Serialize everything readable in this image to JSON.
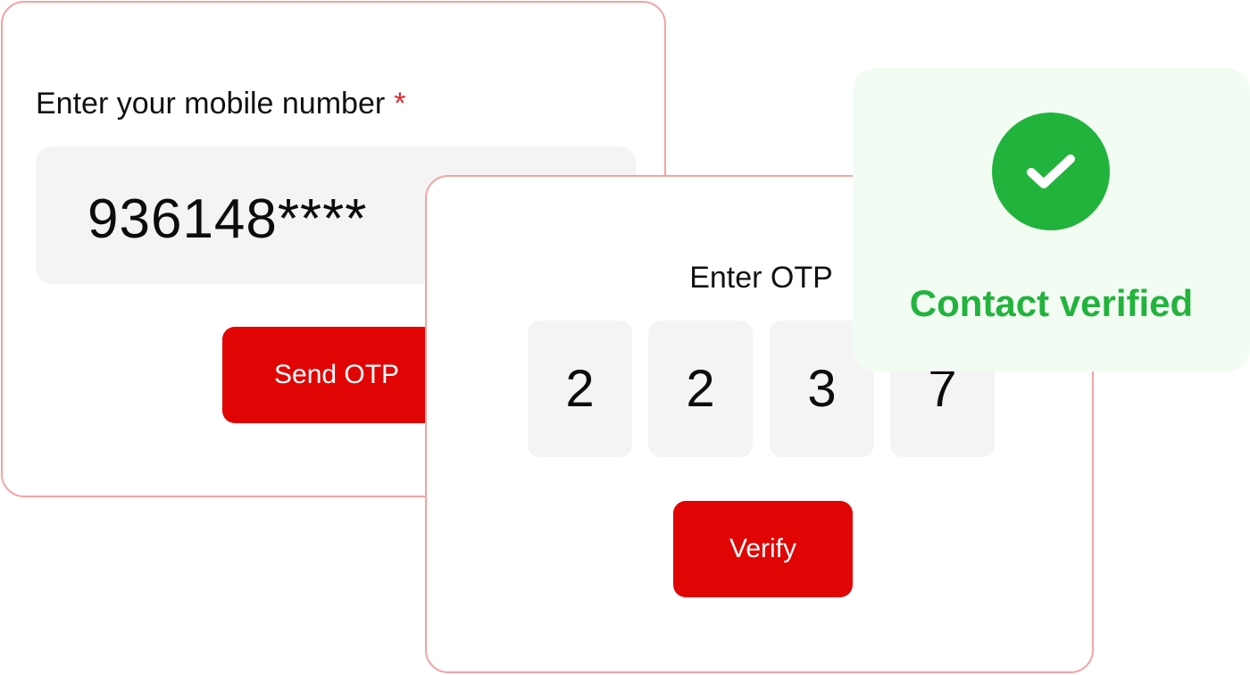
{
  "mobile_card": {
    "label": "Enter your mobile number",
    "required_marker": "*",
    "mobile_value": "936148****",
    "send_button_label": "Send OTP"
  },
  "otp_card": {
    "title": "Enter OTP",
    "digits": [
      "2",
      "2",
      "3",
      "7"
    ],
    "verify_button_label": "Verify"
  },
  "verified_card": {
    "icon": "check-icon",
    "message": "Contact verified"
  },
  "colors": {
    "accent_red": "#e00404",
    "card_border": "#f3a3a3",
    "success_green": "#22b33d",
    "input_background": "#f4f4f4",
    "verified_background": "#f3fcf3"
  }
}
